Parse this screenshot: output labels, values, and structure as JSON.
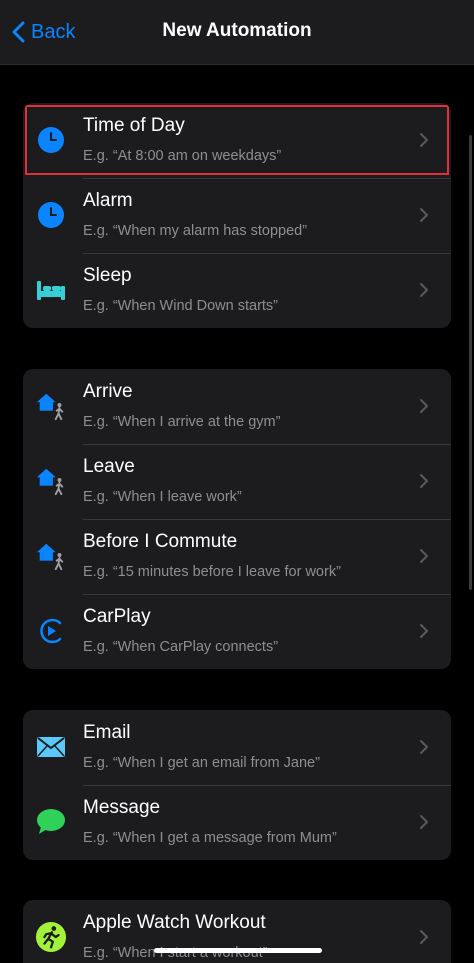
{
  "nav": {
    "back_label": "Back",
    "title": "New Automation"
  },
  "colors": {
    "accent": "#0a84ff",
    "background": "#000000",
    "card": "#1c1c1e",
    "subtitle": "#8e8e93",
    "highlight": "#e0303a",
    "sleep_icon": "#35d0d6",
    "message_icon": "#30d158",
    "workout_icon": "#a2f23a"
  },
  "groups": [
    {
      "items": [
        {
          "title": "Time of Day",
          "subtitle": "E.g. “At 8:00 am on weekdays”",
          "icon": "clock-icon",
          "selected": true
        },
        {
          "title": "Alarm",
          "subtitle": "E.g. “When my alarm has stopped”",
          "icon": "clock-icon"
        },
        {
          "title": "Sleep",
          "subtitle": "E.g. “When Wind Down starts”",
          "icon": "bed-icon"
        }
      ]
    },
    {
      "items": [
        {
          "title": "Arrive",
          "subtitle": "E.g. “When I arrive at the gym”",
          "icon": "home-person-icon"
        },
        {
          "title": "Leave",
          "subtitle": "E.g. “When I leave work”",
          "icon": "home-person-icon"
        },
        {
          "title": "Before I Commute",
          "subtitle": "E.g. “15 minutes before I leave for work”",
          "icon": "home-person-icon"
        },
        {
          "title": "CarPlay",
          "subtitle": "E.g. “When CarPlay connects”",
          "icon": "carplay-icon"
        }
      ]
    },
    {
      "items": [
        {
          "title": "Email",
          "subtitle": "E.g. “When I get an email from Jane”",
          "icon": "envelope-icon"
        },
        {
          "title": "Message",
          "subtitle": "E.g. “When I get a message from Mum”",
          "icon": "message-bubble-icon"
        }
      ]
    },
    {
      "items": [
        {
          "title": "Apple Watch Workout",
          "subtitle": "E.g. “When I start a workout”",
          "icon": "workout-runner-icon"
        }
      ]
    }
  ]
}
